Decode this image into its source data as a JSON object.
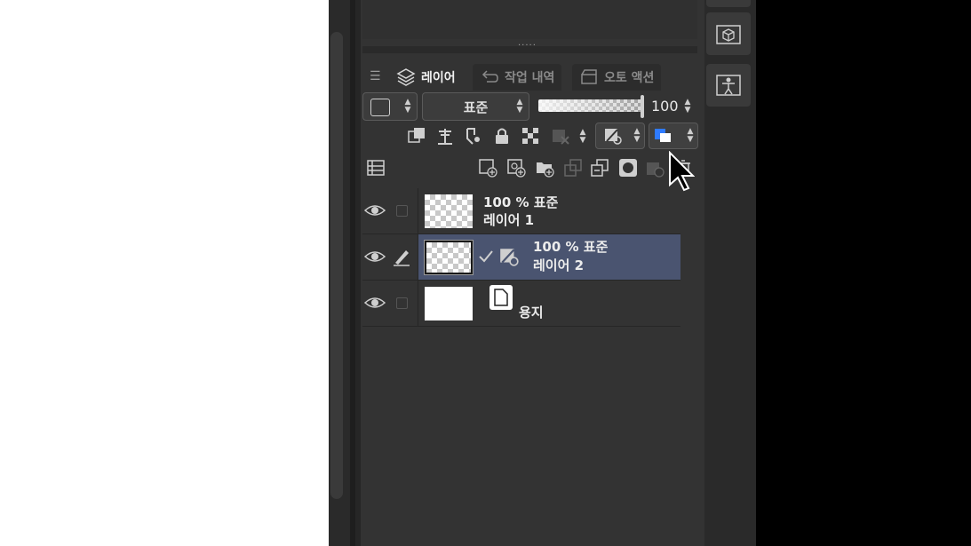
{
  "tabs": [
    {
      "label": "레이어",
      "icon": "layers-icon",
      "active": true
    },
    {
      "label": "작업 내역",
      "icon": "history-icon",
      "active": false
    },
    {
      "label": "오토 액션",
      "icon": "auto-action-icon",
      "active": false
    }
  ],
  "blend": {
    "mode": "표준"
  },
  "opacity": {
    "value": "100",
    "level_percent": 100
  },
  "layers": [
    {
      "mode": "100 % 표준",
      "name": "레이어 1",
      "selected": false
    },
    {
      "mode": "100 % 표준",
      "name": "레이어 2",
      "selected": true
    },
    {
      "mode": "",
      "name": "용지",
      "selected": false
    }
  ],
  "colors": {
    "panel": "#333333",
    "selection": "#4a5470",
    "accent_blue": "#2f7bff"
  }
}
